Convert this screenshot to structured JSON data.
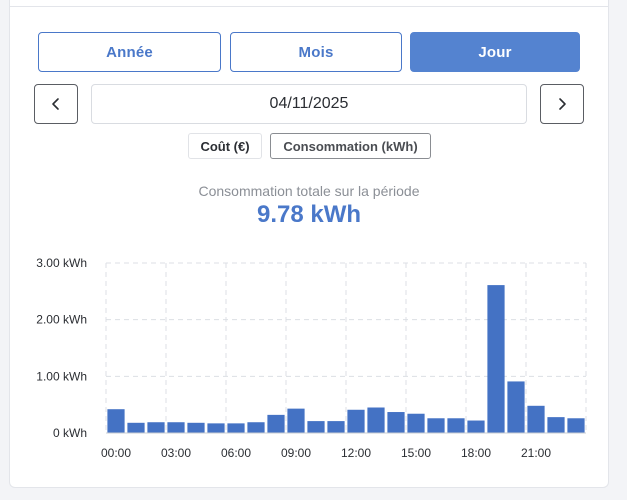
{
  "tabs": [
    {
      "label": "Année",
      "active": false
    },
    {
      "label": "Mois",
      "active": false
    },
    {
      "label": "Jour",
      "active": true
    }
  ],
  "date": {
    "value": "04/11/2025",
    "prev_icon": "chevron-left-icon",
    "next_icon": "chevron-right-icon"
  },
  "toggles": {
    "cost_label": "Coût (€)",
    "consumption_label": "Consommation (kWh)"
  },
  "summary": {
    "label": "Consommation totale sur la période",
    "value": "9.78 kWh"
  },
  "colors": {
    "accent": "#5483d0",
    "bar": "#4472c4",
    "grid": "#dcdfe4"
  },
  "chart_data": {
    "type": "bar",
    "categories": [
      "00:00",
      "01:00",
      "02:00",
      "03:00",
      "04:00",
      "05:00",
      "06:00",
      "07:00",
      "08:00",
      "09:00",
      "10:00",
      "11:00",
      "12:00",
      "13:00",
      "14:00",
      "15:00",
      "16:00",
      "17:00",
      "18:00",
      "19:00",
      "20:00",
      "21:00",
      "22:00",
      "23:00"
    ],
    "values": [
      0.42,
      0.18,
      0.19,
      0.19,
      0.18,
      0.17,
      0.17,
      0.19,
      0.32,
      0.43,
      0.21,
      0.21,
      0.41,
      0.45,
      0.37,
      0.34,
      0.26,
      0.26,
      0.22,
      2.61,
      0.91,
      0.48,
      0.28,
      0.26
    ],
    "y_ticks": [
      {
        "value": 0,
        "label": "0 kWh"
      },
      {
        "value": 1,
        "label": "1.00 kWh"
      },
      {
        "value": 2,
        "label": "2.00 kWh"
      },
      {
        "value": 3,
        "label": "3.00 kWh"
      }
    ],
    "x_ticks": [
      "00:00",
      "03:00",
      "06:00",
      "09:00",
      "12:00",
      "15:00",
      "18:00",
      "21:00"
    ],
    "ylim": [
      0,
      3
    ],
    "title": "",
    "xlabel": "",
    "ylabel": "",
    "grid": true
  }
}
